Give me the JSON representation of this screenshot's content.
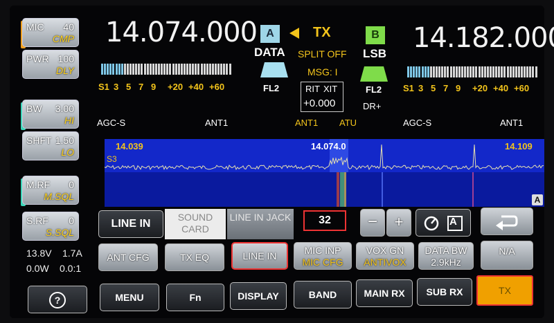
{
  "left_panel": {
    "mic": {
      "label": "MIC",
      "value": "40",
      "sub": "CMP"
    },
    "pwr": {
      "label": "PWR",
      "value": "100",
      "sub": "DLY"
    },
    "bw": {
      "label": "BW",
      "value": "3.00",
      "sub": "HI"
    },
    "shft": {
      "label": "SHFT",
      "value": "1.50",
      "sub": "LO"
    },
    "mrf": {
      "label": "M.RF",
      "value": "0",
      "sub": "M.SQL"
    },
    "srf": {
      "label": "S.RF",
      "value": "0",
      "sub": "S.SQL"
    },
    "voltage": "13.8V",
    "current": "1.7A",
    "power_out": "0.0W",
    "swr": "0.0:1",
    "help_icon": "question-icon"
  },
  "vfo_a": {
    "frequency": "14.074.000",
    "badge": "A",
    "mode": "DATA",
    "filter": "FL2",
    "agc": "AGC-S",
    "ant": "ANT1"
  },
  "vfo_b": {
    "frequency": "14.182.000",
    "badge": "B",
    "mode": "LSB",
    "filter": "FL2",
    "agc": "AGC-S",
    "ant": "ANT1",
    "dr": "DR+"
  },
  "center": {
    "tx": "TX",
    "split": "SPLIT OFF",
    "msg": "MSG: I",
    "rit": "RIT",
    "xit": "XIT",
    "offset": "+0.000",
    "ant": "ANT1",
    "atu": "ATU"
  },
  "meter_scale": [
    "S1",
    "3",
    "5",
    "7",
    "9",
    "+20",
    "+40",
    "+60"
  ],
  "spectrum": {
    "left_freq": "14.039",
    "center_freq": "14.074.0",
    "right_freq": "14.109",
    "s_label": "S3",
    "corner_badge": "A"
  },
  "row1": {
    "line_in": "LINE IN",
    "sound_card": "SOUND CARD",
    "line_in_jack": "LINE IN JACK",
    "level": "32",
    "minus": "−",
    "plus": "+",
    "auto_badge": "A",
    "back_icon": "return-icon"
  },
  "row2": [
    {
      "top": "ANT CFG",
      "bottom": ""
    },
    {
      "top": "TX EQ",
      "bottom": ""
    },
    {
      "top": "LINE IN",
      "bottom": ""
    },
    {
      "top": "MIC INP",
      "bottom": "MIC CFG"
    },
    {
      "top": "VOX GN",
      "bottom": "ANTIVOX"
    },
    {
      "top": "DATA BW",
      "bottom": "2.9kHz"
    },
    {
      "top": "N/A",
      "bottom": ""
    }
  ],
  "row3": [
    "MENU",
    "Fn",
    "DISPLAY",
    "BAND",
    "MAIN RX",
    "SUB RX",
    "TX"
  ],
  "colors": {
    "accent_yellow": "#f3c41b",
    "tx_orange": "#f0a000",
    "marker_teal": "#3cd6b8",
    "marker_orange": "#f0a020",
    "spectrum_blue": "#1328c9"
  }
}
